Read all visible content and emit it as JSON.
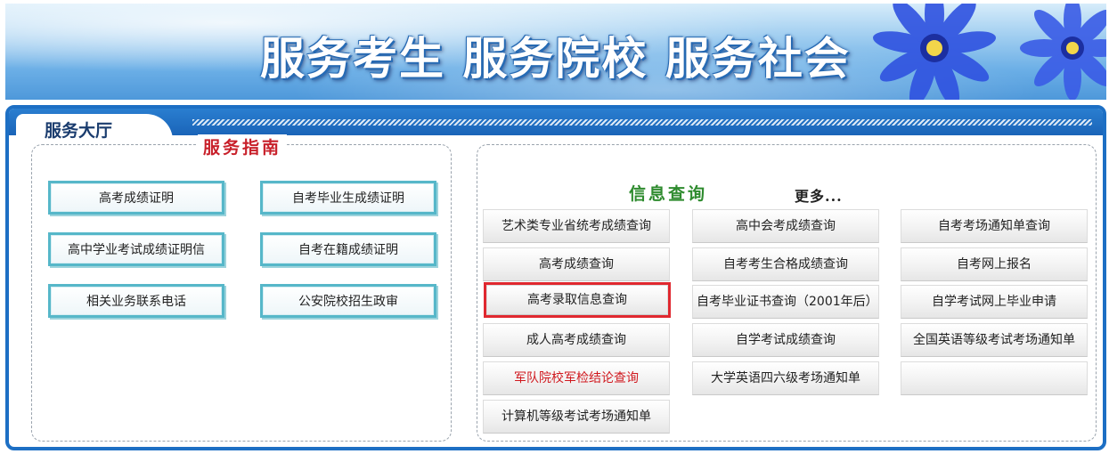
{
  "banner": {
    "slogan": "服务考生 服务院校 服务社会"
  },
  "hall": {
    "title": "服务大厅"
  },
  "guide": {
    "title": "服务指南",
    "buttons": [
      "高考成绩证明",
      "自考毕业生成绩证明",
      "高中学业考试成绩证明信",
      "自考在籍成绩证明",
      "相关业务联系电话",
      "公安院校招生政审"
    ]
  },
  "query": {
    "title": "信息查询",
    "more": "更多...",
    "columns": [
      [
        "艺术类专业省统考成绩查询",
        "高考成绩查询",
        "高考录取信息查询",
        "成人高考成绩查询",
        "军队院校军检结论查询",
        "计算机等级考试考场通知单"
      ],
      [
        "高中会考成绩查询",
        "自考考生合格成绩查询",
        "自考毕业证书查询（2001年后）",
        "自学考试成绩查询",
        "大学英语四六级考场通知单"
      ],
      [
        "自考考场通知单查询",
        "自考网上报名",
        "自学考试网上毕业申请",
        "全国英语等级考试考场通知单",
        ""
      ]
    ],
    "highlighted": "高考录取信息查询",
    "red_item": "军队院校军检结论查询"
  },
  "colors": {
    "panel_border": "#1d6fc4",
    "guide_title": "#c8202a",
    "query_title": "#2e8b2e",
    "highlight": "#e0282f"
  }
}
